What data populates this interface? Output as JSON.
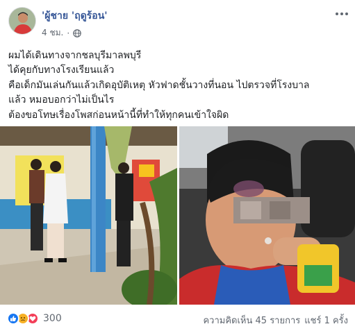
{
  "post": {
    "author": "'ผู้ชาย 'ฤดูร้อน'",
    "time": "4 ชม.",
    "privacy_icon": "globe-icon",
    "more_icon": "more-options-icon",
    "text_lines": [
      "ผมได้เดินทางจากชลบุรีมาลพบุรี",
      "ได้คุยกับทางโรงเรียนแล้ว",
      "คือเด็กมันเล่นกันแล้วเกิดอุบัติเหตุ หัวฟาดชั้นวางที่นอน ไปตรวจที่โรงบาล",
      "แล้ว หมอบอกว่าไม่เป็นไร",
      "ต้องขอโทษเรื่องโพสก่อนหน้านี้ที่ทำให้ทุกคนเข้าใจผิด"
    ]
  },
  "photos": {
    "left_desc_icon": "school-meeting-photo",
    "right_desc_icon": "child-in-car-photo"
  },
  "footer": {
    "reaction_icons": [
      "like-icon",
      "sad-icon",
      "love-icon"
    ],
    "reaction_count": "300",
    "comments": "ความคิดเห็น 45 รายการ",
    "shares": "แชร์ 1 ครั้ง"
  },
  "colors": {
    "author": "#385898",
    "meta": "#606770",
    "like": "#1877f2",
    "sad": "#f7b125",
    "love": "#f33e58"
  }
}
